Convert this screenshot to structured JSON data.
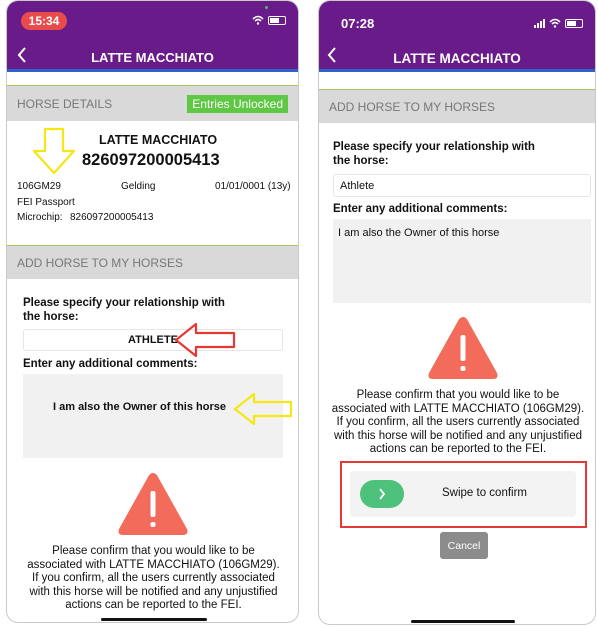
{
  "left": {
    "status_time": "15:34",
    "nav_title": "LATTE MACCHIATO",
    "horse_details_header": "HORSE DETAILS",
    "entries_badge": "Entries Unlocked",
    "horse_name": "LATTE MACCHIATO",
    "horse_id": "826097200005413",
    "fei_id": "106GM29",
    "sex": "Gelding",
    "dob": "01/01/0001 (13y)",
    "passport": "FEI Passport",
    "microchip_label": "Microchip:",
    "microchip_value": "826097200005413",
    "add_header": "ADD HORSE TO MY HORSES",
    "relationship_label_1": "Please specify your relationship with",
    "relationship_label_2": "the horse:",
    "relationship_value": "ATHLETE",
    "comments_label": "Enter any additional comments:",
    "comments_value": "I am also the Owner of this horse",
    "confirm_lines": [
      "Please confirm that you would like to be",
      "associated with LATTE MACCHIATO (106GM29).",
      "If you confirm, all the users currently associated",
      "with this horse will be notified and any unjustified",
      "actions can be reported to the FEI."
    ]
  },
  "right": {
    "status_time": "07:28",
    "nav_title": "LATTE MACCHIATO",
    "add_header": "ADD HORSE TO MY HORSES",
    "relationship_label_1": "Please specify your relationship with",
    "relationship_label_2": "the horse:",
    "relationship_value": "Athlete",
    "comments_label": "Enter any additional comments:",
    "comments_value": "I am also the Owner of this horse",
    "confirm_lines": [
      "Please confirm that you would like to be",
      "associated with LATTE MACCHIATO (106GM29).",
      "If you confirm, all the users currently associated",
      "with this horse will be notified and any unjustified",
      "actions can be reported to the FEI."
    ],
    "swipe_label": "Swipe to confirm",
    "cancel_label": "Cancel"
  },
  "colors": {
    "header_purple": "#6a1b8a",
    "accent_blue": "#2f63c8",
    "badge_green": "#5ec845",
    "warning_red": "#f26b5b",
    "annotation_red": "#e53935",
    "annotation_yellow": "#f5e614"
  },
  "icons": {
    "back": "chevron-left-icon",
    "warning": "exclamation-icon",
    "swipe": "chevron-right-icon"
  }
}
